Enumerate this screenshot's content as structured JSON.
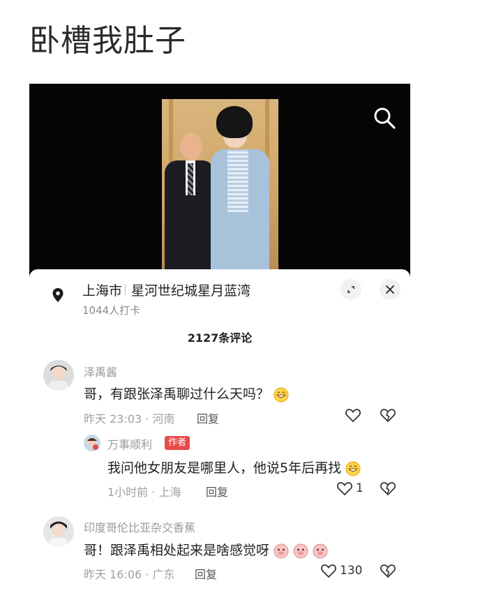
{
  "post": {
    "title": "卧槽我肚子"
  },
  "location": {
    "city": "上海市",
    "place": "星河世纪城星月蓝湾",
    "checkins": "1044人打卡"
  },
  "comments_header": {
    "count_label": "2127条评论"
  },
  "comments": [
    {
      "username": "泽禹酱",
      "text": "哥，有跟张泽禹聊过什么天吗？",
      "time_place": "昨天 23:03 · 河南",
      "reply_label": "回复",
      "likes": ""
    },
    {
      "username": "万事顺利",
      "badge": "作者",
      "text": "我问他女朋友是哪里人，他说5年后再找",
      "time_place": "1小时前 · 上海",
      "reply_label": "回复",
      "likes": "1"
    },
    {
      "username": "印度哥伦比亚杂交香蕉",
      "text": "哥！跟泽禹相处起来是啥感觉呀",
      "time_place": "昨天 16:06 · 广东",
      "reply_label": "回复",
      "likes": "130"
    }
  ],
  "icons": {
    "search": "search-icon",
    "location": "location-pin-icon",
    "expand": "expand-icon",
    "close": "close-icon",
    "like": "heart-icon",
    "dislike": "broken-heart-icon",
    "emoji_grin": "grin-emoji",
    "emoji_pig": "pig-emoji"
  },
  "colors": {
    "author_badge": "#e84a4a",
    "video_bg": "#050505"
  }
}
